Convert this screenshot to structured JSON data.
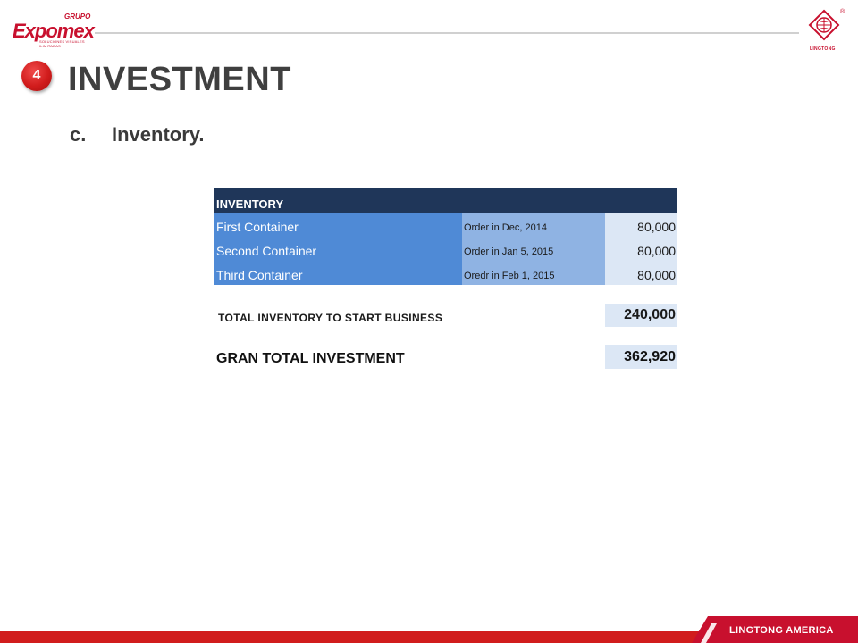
{
  "header": {
    "logo_left": {
      "grupo": "GRUPO",
      "brand": "Expomex",
      "tagline": "SOLUCIONES VISUALES ILIMITADAS"
    },
    "logo_right": {
      "name": "LINGTONG",
      "registered": "®"
    }
  },
  "section": {
    "number": "4",
    "title": "INVESTMENT"
  },
  "subsection": {
    "letter": "c.",
    "label": "Inventory."
  },
  "table": {
    "header": "INVENTORY",
    "rows": [
      {
        "item": "First Container",
        "order": "Order in Dec, 2014",
        "amount": "80,000"
      },
      {
        "item": "Second Container",
        "order": "Order in Jan 5, 2015",
        "amount": "80,000"
      },
      {
        "item": "Third Container",
        "order": "Oredr in Feb 1, 2015",
        "amount": "80,000"
      }
    ],
    "total_inventory": {
      "label": "TOTAL INVENTORY TO START BUSINESS",
      "value": "240,000"
    },
    "grand_total": {
      "label": "GRAN TOTAL INVESTMENT",
      "value": "362,920"
    }
  },
  "footer": {
    "label": "LINGTONG AMERICA"
  },
  "colors": {
    "accent_red": "#d11c1c",
    "table_header": "#1f3659",
    "cell_blue": "#4f8ad6",
    "cell_mid": "#8fb3e3",
    "cell_light": "#dce7f5"
  }
}
